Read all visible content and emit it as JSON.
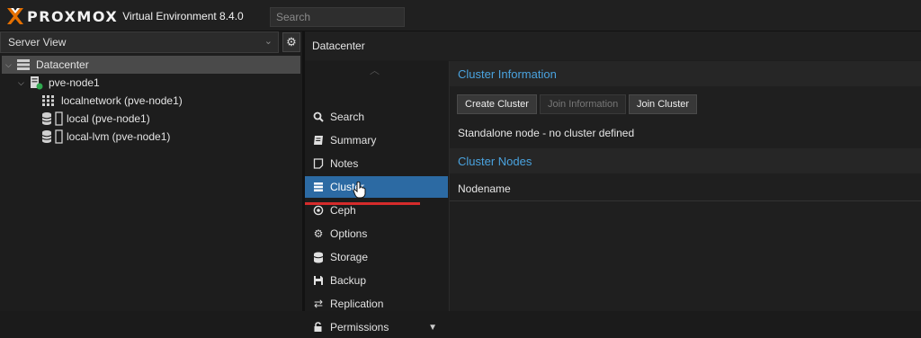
{
  "app": {
    "brand": "PROXMOX",
    "subtitle": "Virtual Environment 8.4.0",
    "search_placeholder": "Search"
  },
  "left": {
    "view": "Server View",
    "tree": [
      {
        "label": "Datacenter"
      },
      {
        "label": "pve-node1"
      },
      {
        "label": "localnetwork (pve-node1)"
      },
      {
        "label": "local (pve-node1)"
      },
      {
        "label": "local-lvm (pve-node1)"
      }
    ]
  },
  "main": {
    "breadcrumb": "Datacenter",
    "nav": [
      {
        "label": "Search",
        "icon": "search-icon"
      },
      {
        "label": "Summary",
        "icon": "book-icon"
      },
      {
        "label": "Notes",
        "icon": "note-icon"
      },
      {
        "label": "Cluster",
        "icon": "server-icon"
      },
      {
        "label": "Ceph",
        "icon": "ceph-icon"
      },
      {
        "label": "Options",
        "icon": "gear-icon"
      },
      {
        "label": "Storage",
        "icon": "database-icon"
      },
      {
        "label": "Backup",
        "icon": "floppy-icon"
      },
      {
        "label": "Replication",
        "icon": "retweet-icon"
      },
      {
        "label": "Permissions",
        "icon": "unlock-icon"
      }
    ],
    "cluster_info_title": "Cluster Information",
    "buttons": {
      "create": "Create Cluster",
      "join_info": "Join Information",
      "join": "Join Cluster"
    },
    "status_text": "Standalone node - no cluster defined",
    "nodes_title": "Cluster Nodes",
    "nodes_column": "Nodename"
  },
  "colors": {
    "accent": "#2c6aa3",
    "title_blue": "#4aa3df",
    "logo_orange": "#e57000",
    "highlight_red": "#d52b2b"
  }
}
